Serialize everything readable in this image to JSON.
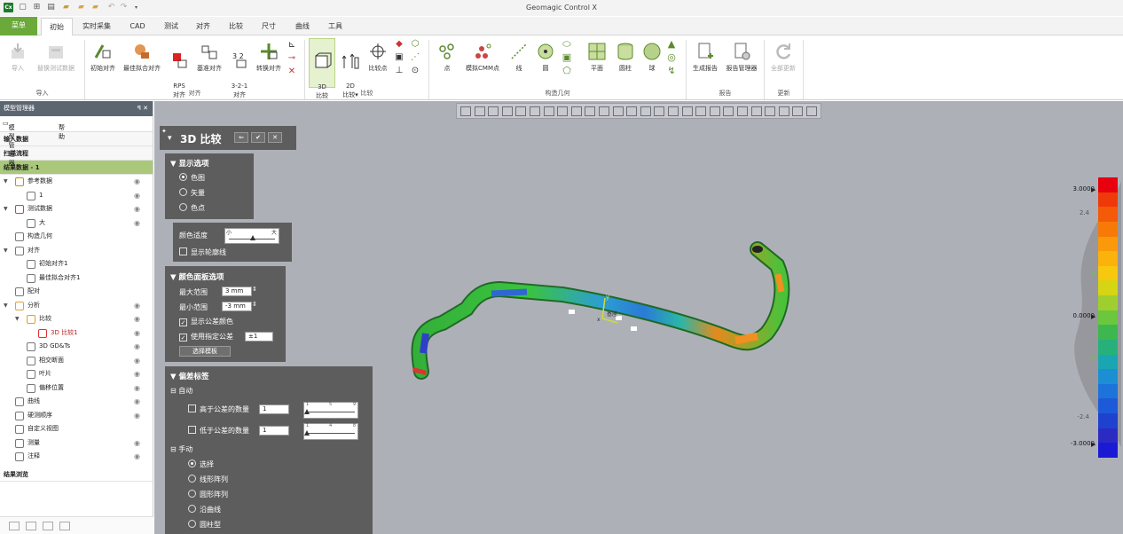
{
  "app": {
    "title": "Geomagic Control X"
  },
  "quick_access": {
    "icons": [
      "app-logo-icon",
      "new-icon",
      "open-icon",
      "save-icon",
      "import-icon",
      "folder-icon",
      "folder-open-icon",
      "undo-icon",
      "redo-icon",
      "customize-icon"
    ],
    "logo_text": "Cx"
  },
  "tabs": [
    {
      "label": "菜单",
      "state": "menu"
    },
    {
      "label": "初始",
      "state": "active"
    },
    {
      "label": "实时采集",
      "state": "normal"
    },
    {
      "label": "CAD",
      "state": "normal"
    },
    {
      "label": "测试",
      "state": "normal"
    },
    {
      "label": "对齐",
      "state": "normal"
    },
    {
      "label": "比较",
      "state": "normal"
    },
    {
      "label": "尺寸",
      "state": "normal"
    },
    {
      "label": "曲线",
      "state": "normal"
    },
    {
      "label": "工具",
      "state": "normal"
    }
  ],
  "ribbon": {
    "import": {
      "label": "导入",
      "btn_import": "导入",
      "btn_replace": "替换测试数据"
    },
    "align": {
      "label": "对齐",
      "initial": "初始对齐",
      "bestfit": "最佳拟合对齐",
      "rps": "RPS\n对齐",
      "datum": "基准对齐",
      "three21": "3-2-1\n对齐",
      "transform": "转换对齐"
    },
    "compare": {
      "label": "比较",
      "c3d": "3D\n比较",
      "c2d": "2D\n比较",
      "c2d_arrow": "▾",
      "compare_points": "比较点"
    },
    "construct": {
      "label": "构造几何",
      "point": "点",
      "cmm": "模拟CMM点",
      "line": "线",
      "circle": "圆",
      "plane": "平面",
      "cylinder": "圆柱",
      "sphere": "球"
    },
    "report": {
      "label": "报告",
      "generate": "生成报告",
      "manager": "报告管理器"
    },
    "update": {
      "label": "更新",
      "all": "全部更新"
    }
  },
  "model_manager": {
    "header": "模型管理器",
    "header_controls": "ꟼ ✕",
    "tab_manager": "模型管理器",
    "tab_help": "帮助",
    "sections": {
      "input": "输入数据",
      "scan": "扫描流程",
      "results": "结果数据 - 1",
      "results_browse": "结果浏览"
    },
    "tree": [
      {
        "label": "参考数据",
        "level": 0,
        "arrow": "▼",
        "icon": "reference-data-icon",
        "eye": true
      },
      {
        "label": "1",
        "level": 1,
        "arrow": "",
        "icon": "cad-body-icon",
        "eye": true
      },
      {
        "label": "测试数据",
        "level": 0,
        "arrow": "▼",
        "icon": "measured-data-icon",
        "eye": true
      },
      {
        "label": "大",
        "level": 1,
        "arrow": "",
        "icon": "mesh-icon",
        "eye": true
      },
      {
        "label": "构造几何",
        "level": 0,
        "arrow": "",
        "icon": "construct-geometry-icon",
        "eye": false
      },
      {
        "label": "对齐",
        "level": 0,
        "arrow": "▼",
        "icon": "align-icon",
        "eye": false
      },
      {
        "label": "初始对齐1",
        "level": 1,
        "arrow": "",
        "icon": "initial-align-icon",
        "eye": false
      },
      {
        "label": "最佳拟合对齐1",
        "level": 1,
        "arrow": "",
        "icon": "bestfit-align-icon",
        "eye": false
      },
      {
        "label": "配对",
        "level": 0,
        "arrow": "",
        "icon": "pairing-icon",
        "eye": false
      },
      {
        "label": "分析",
        "level": 0,
        "arrow": "▼",
        "icon": "analysis-folder-icon",
        "eye": true
      },
      {
        "label": "比较",
        "level": 1,
        "arrow": "▼",
        "icon": "compare-icon",
        "eye": true
      },
      {
        "label": "3D 比较1",
        "level": 2,
        "arrow": "",
        "icon": "compare-3d-icon",
        "eye": true,
        "active": true
      },
      {
        "label": "3D GD&Ts",
        "level": 1,
        "arrow": "",
        "icon": "gdt-icon",
        "eye": true
      },
      {
        "label": "相交断面",
        "level": 1,
        "arrow": "",
        "icon": "section-icon",
        "eye": true
      },
      {
        "label": "叶片",
        "level": 1,
        "arrow": "",
        "icon": "blade-icon",
        "eye": true
      },
      {
        "label": "偏移位置",
        "level": 1,
        "arrow": "",
        "icon": "offset-icon",
        "eye": true
      },
      {
        "label": "曲线",
        "level": 0,
        "arrow": "",
        "icon": "curve-icon",
        "eye": true
      },
      {
        "label": "硬测顺序",
        "level": 0,
        "arrow": "",
        "icon": "probe-sequence-icon",
        "eye": true
      },
      {
        "label": "自定义视图",
        "level": 0,
        "arrow": "",
        "icon": "custom-view-icon",
        "eye": false
      },
      {
        "label": "测量",
        "level": 0,
        "arrow": "",
        "icon": "measure-icon",
        "eye": true
      },
      {
        "label": "注释",
        "level": 0,
        "arrow": "",
        "icon": "note-icon",
        "eye": true
      }
    ]
  },
  "compare_panel": {
    "title": "3D 比较",
    "buttons": {
      "back": "⇐",
      "ok": "✔",
      "cancel": "✕"
    },
    "display": {
      "title": "▼ 显示选项",
      "options": [
        "色图",
        "矢量",
        "色点"
      ],
      "selected": 0
    },
    "color_settings": {
      "label": "颜色适度",
      "min": "小",
      "max": "大",
      "level": 0.5,
      "show_contour": "显示轮廓线",
      "show_contour_checked": false
    },
    "color_panel": {
      "title": "▼ 颜色面板选项",
      "max_label": "最大范围",
      "max_value": "3 mm",
      "min_label": "最小范围",
      "min_value": "-3 mm",
      "show_tol": "显示公差颜色",
      "show_tol_checked": true,
      "use_tol": "使用指定公差",
      "use_tol_checked": true,
      "tol_value": "±1",
      "template_btn": "选择模板"
    },
    "deviation": {
      "title": "▼ 偏差标签",
      "auto": "⊟ 自动",
      "above": "高于公差的数量",
      "above_count": "1",
      "above_ticks": [
        "1",
        "5",
        "9"
      ],
      "above_level": 0,
      "below": "低于公差的数量",
      "below_count": "1",
      "below_ticks": [
        "1",
        "4",
        "8"
      ],
      "below_level": 0,
      "manual": "⊟ 手动",
      "manual_options": [
        "选择",
        "线形阵列",
        "圆形阵列",
        "沿曲线",
        "圆柱型"
      ],
      "manual_selected": 0
    }
  },
  "viewport": {
    "axis_x": "x",
    "axis_y": "y",
    "axis_label": "基座"
  },
  "color_bar": {
    "max": "3.0000",
    "upper": "2.4",
    "zero": "0.0000",
    "lower": "-2.4",
    "min": "-3.0000",
    "colors": [
      "#e8000f",
      "#ee3a09",
      "#f45a07",
      "#f77a08",
      "#fa990a",
      "#fbb20a",
      "#f7c80d",
      "#d6d514",
      "#9ecf2f",
      "#6bc73b",
      "#3db84e",
      "#27b07a",
      "#1aa5b3",
      "#1c8fd4",
      "#1c74da",
      "#1d5ad9",
      "#1f41d0",
      "#2b2bc4",
      "#1a1ad5"
    ]
  }
}
